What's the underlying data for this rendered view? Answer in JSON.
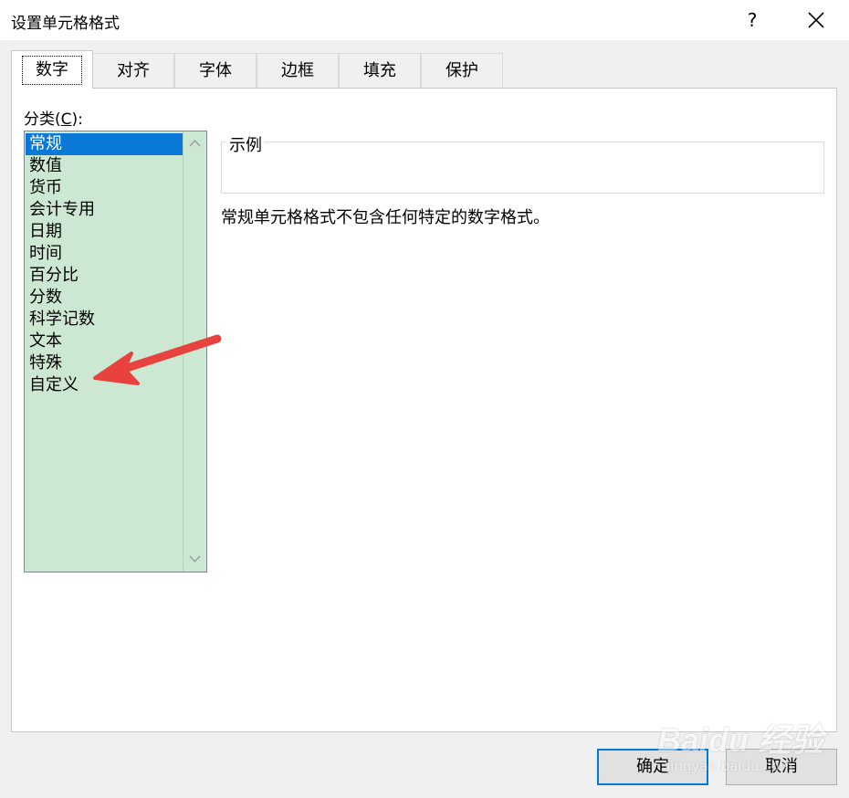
{
  "window": {
    "title": "设置单元格格式",
    "help_label": "?",
    "close_icon": "close-icon"
  },
  "tabs": [
    {
      "label": "数字",
      "active": true
    },
    {
      "label": "对齐",
      "active": false
    },
    {
      "label": "字体",
      "active": false
    },
    {
      "label": "边框",
      "active": false
    },
    {
      "label": "填充",
      "active": false
    },
    {
      "label": "保护",
      "active": false
    }
  ],
  "category": {
    "label_prefix": "分类(",
    "accelerator": "C",
    "label_suffix": "):",
    "selected_index": 0,
    "items": [
      "常规",
      "数值",
      "货币",
      "会计专用",
      "日期",
      "时间",
      "百分比",
      "分数",
      "科学记数",
      "文本",
      "特殊",
      "自定义"
    ],
    "list_bg_color": "#cde8d2",
    "selected_color": "#0a78d7"
  },
  "sample": {
    "legend": "示例",
    "value": ""
  },
  "description": "常规单元格格式不包含任何特定的数字格式。",
  "annotation": {
    "arrow_color": "#e8423f",
    "points_to": "自定义"
  },
  "buttons": {
    "ok": "确定",
    "cancel": "取消"
  },
  "watermark": {
    "logo": "Baidu 经验",
    "sub": "jingyan.baidu.com"
  }
}
